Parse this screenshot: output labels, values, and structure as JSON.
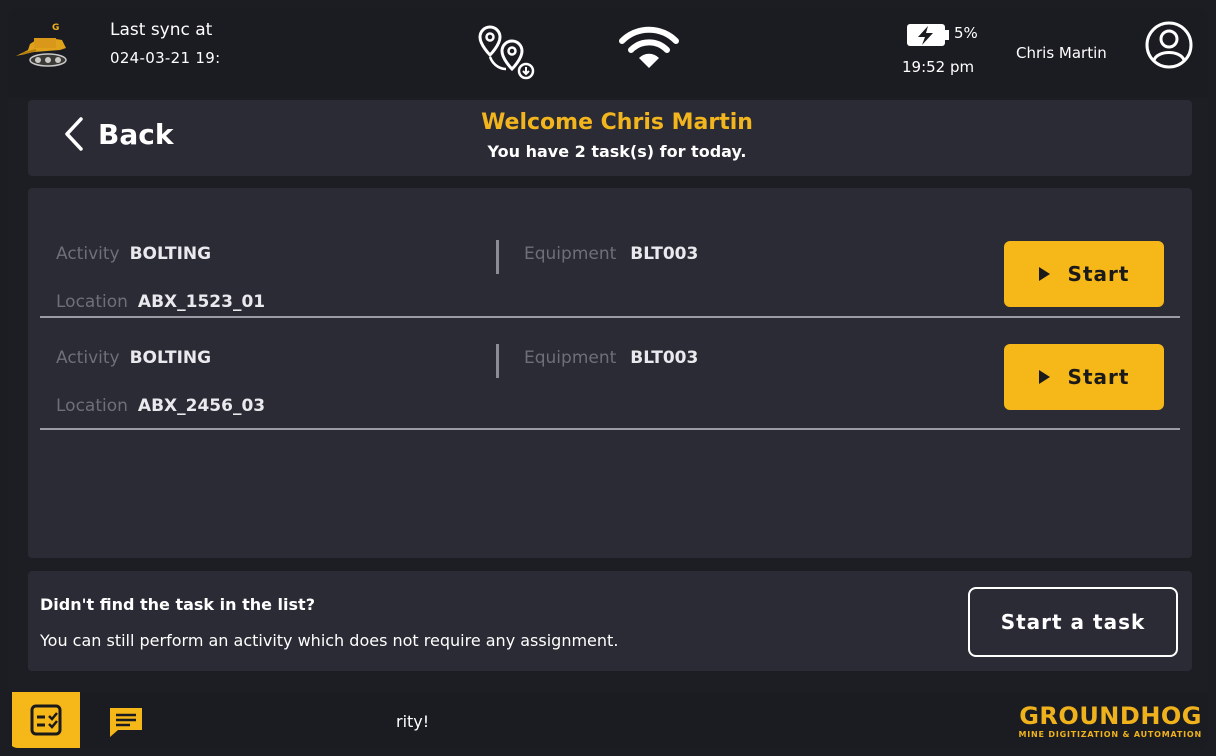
{
  "status_bar": {
    "sync_label": "Last sync at",
    "sync_time": "024-03-21 19:",
    "battery_percent": "5%",
    "time": "19:52 pm",
    "user_name": "Chris Martin"
  },
  "header": {
    "back_label": "Back",
    "welcome": "Welcome Chris Martin",
    "task_summary": "You have 2 task(s) for today."
  },
  "tasks": [
    {
      "activity_label": "Activity",
      "activity": "BOLTING",
      "location_label": "Location",
      "location": "ABX_1523_01",
      "equipment_label": "Equipment",
      "equipment": "BLT003",
      "button_label": "Start"
    },
    {
      "activity_label": "Activity",
      "activity": "BOLTING",
      "location_label": "Location",
      "location": "ABX_2456_03",
      "equipment_label": "Equipment",
      "equipment": "BLT003",
      "button_label": "Start"
    }
  ],
  "hint": {
    "title": "Didn't find the task in the list?",
    "body": "You can still perform an activity which does not require any assignment.",
    "button_label": "Start a task"
  },
  "bottom_bar": {
    "ticker": "rity!",
    "brand_name": "GROUNDHOG",
    "brand_tagline": "MINE DIGITIZATION & AUTOMATION"
  },
  "colors": {
    "accent": "#f6b718",
    "background": "#1d1e24",
    "panel": "#2a2b34"
  }
}
